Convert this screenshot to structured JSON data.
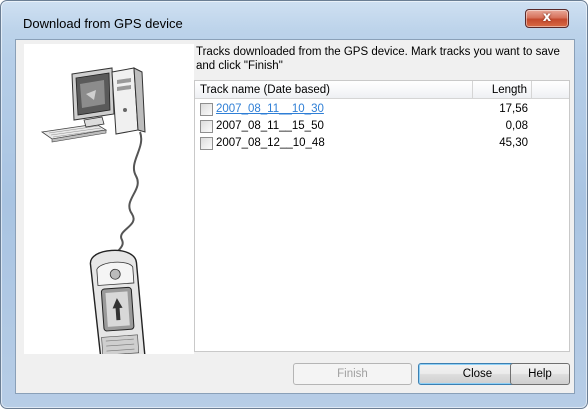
{
  "window": {
    "title": "Download from GPS device",
    "close_glyph": "x"
  },
  "instructions": "Tracks downloaded from the GPS device. Mark tracks you want to save and click \"Finish\"",
  "tracks_table": {
    "columns": [
      "Track name (Date based)",
      "Length"
    ],
    "rows": [
      {
        "name": "2007_08_11__10_30",
        "length": "17,56",
        "checked": false,
        "hovered": true
      },
      {
        "name": "2007_08_11__15_50",
        "length": "0,08",
        "checked": false,
        "hovered": false
      },
      {
        "name": "2007_08_12__10_48",
        "length": "45,30",
        "checked": false,
        "hovered": false
      }
    ]
  },
  "buttons": {
    "finish": "Finish",
    "close": "Close",
    "help": "Help"
  },
  "illustration": {
    "icons": [
      "computer-tower-icon",
      "crt-monitor-icon",
      "keyboard-icon",
      "usb-cable-icon",
      "handheld-gps-icon"
    ]
  },
  "colors": {
    "link": "#2f7fd6",
    "titlebar": "#bcd3ea",
    "close_button": "#c44a2e"
  }
}
